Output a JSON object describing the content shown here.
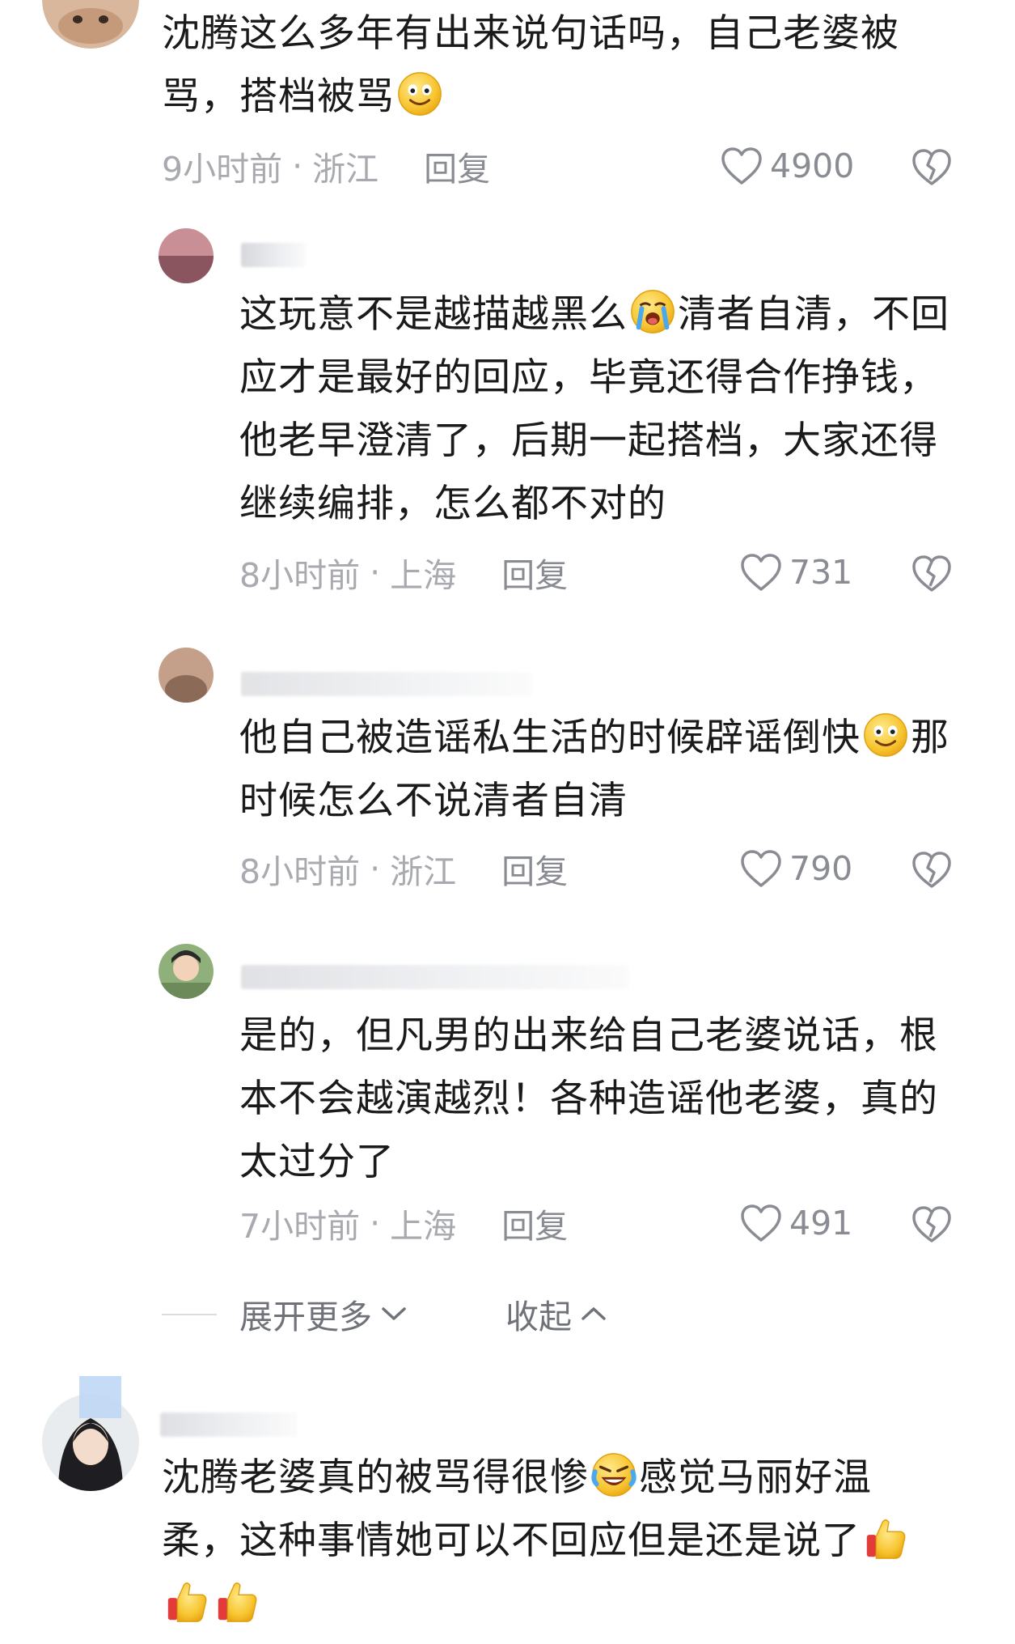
{
  "comments": [
    {
      "text_part1": "沈腾这么多年有出来说句话吗，自己老婆被骂，搭档被骂",
      "emoji1": "smile-emoji",
      "time": "9小时前",
      "location": "浙江",
      "reply_label": "回复",
      "likes": "4900"
    },
    {
      "text_part1": "这玩意不是越描越黑么",
      "emoji1": "crying-emoji",
      "text_part2": "清者自清，不回应才是最好的回应，毕竟还得合作挣钱，他老早澄清了，后期一起搭档，大家还得继续编排，怎么都不对的",
      "time": "8小时前",
      "location": "上海",
      "reply_label": "回复",
      "likes": "731"
    },
    {
      "text_part1": "他自己被造谣私生活的时候辟谣倒快",
      "emoji1": "smile-emoji",
      "text_part2": "那时候怎么不说清者自清",
      "time": "8小时前",
      "location": "浙江",
      "reply_label": "回复",
      "likes": "790"
    },
    {
      "text_part1": "是的，但凡男的出来给自己老婆说话，根本不会越演越烈！各种造谣他老婆，真的太过分了",
      "time": "7小时前",
      "location": "上海",
      "reply_label": "回复",
      "likes": "491"
    },
    {
      "text_part1": "沈腾老婆真的被骂得很惨",
      "emoji1": "crying-laugh-emoji",
      "text_part2": "感觉马丽好温柔，这种事情她可以不回应但是还是说了",
      "emoji2": "thumbs-up-emoji"
    }
  ],
  "expand": {
    "more_label": "展开更多",
    "collapse_label": "收起"
  },
  "colors": {
    "meta_gray": "#a8aab0",
    "text": "#1a1a1a",
    "background": "#ffffff"
  }
}
